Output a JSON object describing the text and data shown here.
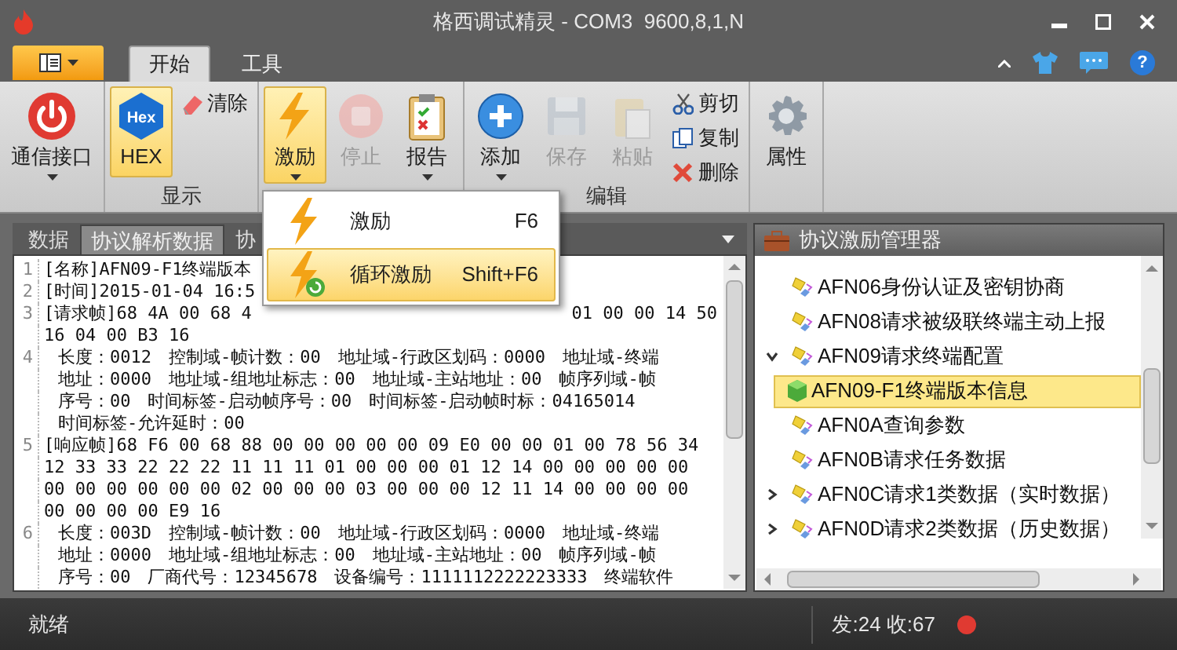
{
  "window": {
    "title": "格西调试精灵 - COM3  9600,8,1,N"
  },
  "ribbon_tabs": [
    {
      "label": "开始",
      "selected": true
    },
    {
      "label": "工具",
      "selected": false
    }
  ],
  "ribbon_groups": [
    {
      "buttons": [
        {
          "label": "通信接口",
          "kind": "large",
          "pressed": false,
          "disabled": false,
          "dropdown": true
        }
      ]
    },
    {
      "label": "显示",
      "buttons": [
        {
          "label": "HEX",
          "icon_text": "Hex",
          "kind": "large",
          "pressed": true,
          "disabled": false,
          "dropdown": false
        },
        {
          "label": "清除",
          "kind": "small",
          "pressed": false,
          "disabled": false,
          "dropdown": false
        }
      ]
    },
    {
      "buttons": [
        {
          "label": "激励",
          "kind": "large",
          "pressed": true,
          "disabled": false,
          "dropdown": true
        },
        {
          "label": "停止",
          "kind": "large",
          "pressed": false,
          "disabled": true,
          "dropdown": false
        },
        {
          "label": "报告",
          "kind": "large",
          "pressed": false,
          "disabled": false,
          "dropdown": true
        }
      ]
    },
    {
      "label": "编辑",
      "buttons": [
        {
          "label": "添加",
          "kind": "large",
          "pressed": false,
          "disabled": false,
          "dropdown": true
        },
        {
          "label": "保存",
          "kind": "large",
          "pressed": false,
          "disabled": true,
          "dropdown": false
        },
        {
          "label": "粘贴",
          "kind": "large",
          "pressed": false,
          "disabled": true,
          "dropdown": false
        },
        {
          "label": "剪切",
          "kind": "small",
          "pressed": false,
          "disabled": false,
          "dropdown": false
        },
        {
          "label": "复制",
          "kind": "small",
          "pressed": false,
          "disabled": false,
          "dropdown": false
        },
        {
          "label": "删除",
          "kind": "small",
          "pressed": false,
          "disabled": false,
          "dropdown": false
        }
      ]
    },
    {
      "buttons": [
        {
          "label": "属性",
          "kind": "large",
          "pressed": false,
          "disabled": false,
          "dropdown": false
        }
      ]
    }
  ],
  "dropdown_menu": [
    {
      "label": "激励",
      "shortcut": "F6",
      "selected": false
    },
    {
      "label": "循环激励",
      "shortcut": "Shift+F6",
      "selected": true
    }
  ],
  "data_panel": {
    "tabs": [
      {
        "label": "数据",
        "selected": false
      },
      {
        "label": "协议解析数据",
        "selected": true
      },
      {
        "label": "协",
        "selected": false
      }
    ],
    "lines": [
      {
        "number": "1",
        "kind": "text",
        "rows": [
          {
            "text": "[名称]AFN09-F1终端版本"
          }
        ]
      },
      {
        "number": "2",
        "kind": "text",
        "rows": [
          {
            "text": "[时间]2015-01-04 16:5"
          }
        ]
      },
      {
        "number": "3",
        "kind": "text",
        "rows": [
          {
            "text": "[请求帧]68 4A 00 68 4",
            "tail": "01 00 00 14 50"
          },
          {
            "text": "16 04 00 B3 16"
          }
        ]
      },
      {
        "number": "4",
        "kind": "detail",
        "rows": [
          {
            "text": "长度：0012　控制域-帧计数：00　地址域-行政区划码：0000　地址域-终端"
          },
          {
            "text": "地址：0000　地址域-组地址标志：00　地址域-主站地址：00　帧序列域-帧"
          },
          {
            "text": "序号：00　时间标签-启动帧序号：00　时间标签-启动帧时标：04165014"
          },
          {
            "text": "时间标签-允许延时：00"
          }
        ]
      },
      {
        "number": "5",
        "kind": "text",
        "rows": [
          {
            "text": "[响应帧]68 F6 00 68 88 00 00 00 00 00 09 E0 00 00 01 00 78 56 34"
          },
          {
            "text": "12 33 33 22 22 22 11 11 11 01 00 00 00 01 12 14 00 00 00 00 00"
          },
          {
            "text": "00 00 00 00 00 00 02 00 00 00 03 00 00 00 12 11 14 00 00 00 00"
          },
          {
            "text": "00 00 00 00 E9 16"
          }
        ]
      },
      {
        "number": "6",
        "kind": "detail",
        "rows": [
          {
            "text": "长度：003D　控制域-帧计数：00　地址域-行政区划码：0000　地址域-终端"
          },
          {
            "text": "地址：0000　地址域-组地址标志：00　地址域-主站地址：00　帧序列域-帧"
          },
          {
            "text": "序号：00　厂商代号：12345678　设备编号：1111112222223333　终端软件"
          }
        ]
      }
    ]
  },
  "manager_panel": {
    "title": "协议激励管理器",
    "tree": [
      {
        "label": "AFN06身份认证及密钥协商"
      },
      {
        "label": "AFN08请求被级联终端主动上报"
      },
      {
        "label": "AFN09请求终端配置",
        "expanded": true,
        "children": [
          {
            "label": "AFN09-F1终端版本信息",
            "selected": true
          }
        ]
      },
      {
        "label": "AFN0A查询参数"
      },
      {
        "label": "AFN0B请求任务数据"
      },
      {
        "label": "AFN0C请求1类数据（实时数据）",
        "expanded": false
      },
      {
        "label": "AFN0D请求2类数据（历史数据）",
        "expanded": false
      }
    ]
  },
  "help_button": "?",
  "status_bar": {
    "text": "就绪",
    "counts": "发:24 收:67"
  }
}
